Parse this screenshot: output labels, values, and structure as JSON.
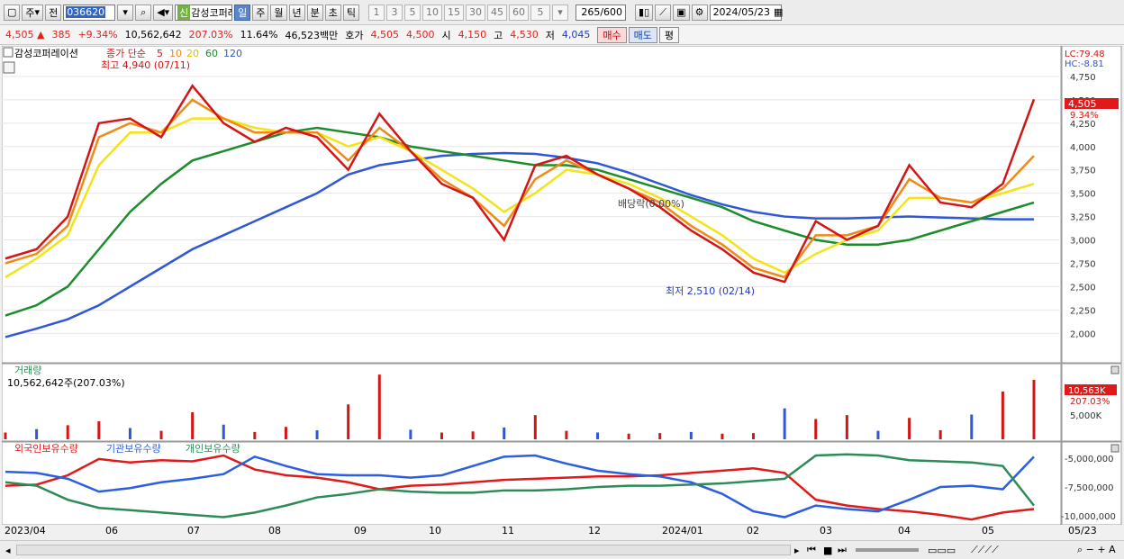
{
  "toolbar": {
    "type_select": "주",
    "prev_label": "전",
    "stock_code": "036620",
    "stock_name": "감성코퍼레",
    "new_badge": "신",
    "periods": [
      "일",
      "주",
      "월",
      "년",
      "분",
      "초",
      "틱"
    ],
    "active_period": "일",
    "intervals": [
      "1",
      "3",
      "5",
      "10",
      "15",
      "30",
      "45",
      "60"
    ],
    "interval_value": "5",
    "count": "265",
    "count_total": "/600",
    "date": "2024/05/23"
  },
  "info": {
    "price": "4,505",
    "change_arrow": "▲",
    "change": "385",
    "change_pct": "+9.34%",
    "volume": "10,562,642",
    "volume_ratio": "207.03%",
    "turnover": "11.64%",
    "amount": "46,523백만",
    "bid_label": "호가",
    "ask": "4,505",
    "bid": "4,500",
    "open_label": "시",
    "open": "4,150",
    "high_label": "고",
    "high": "4,530",
    "low_label": "저",
    "low": "4,045",
    "buy_btn": "매수",
    "sell_btn": "매도",
    "avg_btn": "평"
  },
  "main_chart": {
    "name_label": "감성코퍼레이션",
    "ma_label": "종가 단순",
    "ma_periods": [
      "5",
      "10",
      "20",
      "60",
      "120"
    ],
    "ma_colors": [
      "#d41515",
      "#f08a14",
      "#f2e419",
      "#1d8c2a",
      "#2f57d6"
    ],
    "high_note": "최고 4,940 (07/11)",
    "low_note": "최저 2,510 (02/14)",
    "dividend_note": "배당락(0.00%)",
    "lc": "LC:79.48",
    "hc": "HC:-8.81",
    "last_price_tag": "4,505",
    "last_pct_tag": "9.34%",
    "y_ticks": [
      "4,750",
      "4,500",
      "4,250",
      "4,000",
      "3,750",
      "3,500",
      "3,250",
      "3,000",
      "2,750",
      "2,500",
      "2,250",
      "2,000"
    ]
  },
  "volume_panel": {
    "title": "거래량",
    "value_label": "10,562,642주(207.03%)",
    "last_tag": "10,563K",
    "pct_tag": "207.03%",
    "y_tick": "5,000K"
  },
  "holdings_panel": {
    "series": [
      {
        "name": "외국인보유수량",
        "color": "#e01a1a"
      },
      {
        "name": "기관보유수량",
        "color": "#2b5fe0"
      },
      {
        "name": "개인보유수량",
        "color": "#2e8b57"
      }
    ],
    "y_ticks": [
      "-5,000,000",
      "-7,500,000",
      "-10,000,000"
    ]
  },
  "x_axis": [
    "2023/04",
    "06",
    "07",
    "08",
    "09",
    "10",
    "11",
    "12",
    "2024/01",
    "02",
    "03",
    "04",
    "05",
    "05/23"
  ],
  "chart_data": [
    {
      "type": "line",
      "title": "",
      "ylabel": "",
      "ylim": [
        1800,
        5000
      ],
      "series": [
        {
          "name": "",
          "color": "#d41515",
          "values": [
            2800,
            2900,
            3250,
            4250,
            4300,
            4100,
            4650,
            4250,
            4050,
            4200,
            4100,
            3750,
            4350,
            3950,
            3600,
            3450,
            3000,
            3800,
            3900,
            3700,
            3550,
            3350,
            3100,
            2900,
            2650,
            2550,
            3200,
            3000,
            3150,
            3800,
            3400,
            3350,
            3600,
            4505
          ]
        },
        {
          "name": "",
          "color": "#f08a14",
          "values": [
            2750,
            2850,
            3150,
            4100,
            4250,
            4150,
            4500,
            4300,
            4150,
            4150,
            4150,
            3850,
            4200,
            3950,
            3650,
            3450,
            3150,
            3650,
            3850,
            3700,
            3550,
            3400,
            3150,
            2950,
            2700,
            2600,
            3050,
            3050,
            3150,
            3650,
            3450,
            3400,
            3550,
            3900
          ]
        },
        {
          "name": "",
          "color": "#f2e419",
          "values": [
            2600,
            2800,
            3050,
            3800,
            4150,
            4150,
            4300,
            4300,
            4200,
            4150,
            4150,
            4000,
            4100,
            3950,
            3750,
            3550,
            3300,
            3500,
            3750,
            3700,
            3600,
            3450,
            3250,
            3050,
            2800,
            2650,
            2850,
            3000,
            3100,
            3450,
            3450,
            3400,
            3500,
            3600
          ]
        },
        {
          "name": "",
          "color": "#1d8c2a",
          "values": [
            2190,
            2300,
            2500,
            2900,
            3300,
            3600,
            3850,
            3950,
            4050,
            4150,
            4200,
            4150,
            4100,
            4000,
            3950,
            3900,
            3850,
            3800,
            3800,
            3750,
            3650,
            3550,
            3450,
            3350,
            3200,
            3100,
            3000,
            2950,
            2950,
            3000,
            3100,
            3200,
            3300,
            3400
          ]
        },
        {
          "name": "",
          "color": "#2f57d6",
          "values": [
            1960,
            2050,
            2150,
            2300,
            2500,
            2700,
            2900,
            3050,
            3200,
            3350,
            3500,
            3700,
            3800,
            3850,
            3900,
            3920,
            3930,
            3920,
            3880,
            3820,
            3720,
            3600,
            3480,
            3380,
            3300,
            3250,
            3230,
            3230,
            3240,
            3250,
            3240,
            3230,
            3220,
            3220
          ]
        }
      ]
    },
    {
      "type": "bar",
      "title": "",
      "ylim": [
        0,
        12000
      ],
      "values": [
        1200,
        1800,
        2500,
        3200,
        2000,
        1500,
        4800,
        2600,
        1300,
        2200,
        1600,
        6200,
        11500,
        1700,
        1200,
        1400,
        2100,
        4300,
        1500,
        1200,
        1000,
        1100,
        1300,
        1000,
        1100,
        5500,
        3600,
        4300,
        1500,
        3800,
        1600,
        4400,
        8500,
        10563
      ]
    },
    {
      "type": "line",
      "title": "",
      "ylim": [
        -10500000,
        -4000000
      ],
      "series": [
        {
          "name": "외국인보유수량",
          "color": "#e01a1a",
          "values": [
            -7300000,
            -7200000,
            -6400000,
            -5000000,
            -5300000,
            -5100000,
            -5200000,
            -4700000,
            -5900000,
            -6400000,
            -6600000,
            -7000000,
            -7600000,
            -7300000,
            -7200000,
            -7000000,
            -6800000,
            -6700000,
            -6600000,
            -6500000,
            -6500000,
            -6400000,
            -6200000,
            -6000000,
            -5800000,
            -6200000,
            -8500000,
            -9000000,
            -9300000,
            -9500000,
            -9800000,
            -10200000,
            -9600000,
            -9300000
          ]
        },
        {
          "name": "기관보유수량",
          "color": "#2b5fe0",
          "values": [
            -6100000,
            -6200000,
            -6700000,
            -7800000,
            -7500000,
            -7000000,
            -6700000,
            -6300000,
            -4800000,
            -5600000,
            -6300000,
            -6400000,
            -6400000,
            -6600000,
            -6400000,
            -5600000,
            -4800000,
            -4700000,
            -5400000,
            -6000000,
            -6300000,
            -6500000,
            -7000000,
            -8000000,
            -9500000,
            -10000000,
            -9000000,
            -9300000,
            -9500000,
            -8500000,
            -7400000,
            -7300000,
            -7600000,
            -4800000
          ]
        },
        {
          "name": "개인보유수량",
          "color": "#2e8b57",
          "values": [
            -7000000,
            -7300000,
            -8500000,
            -9200000,
            -9400000,
            -9600000,
            -9800000,
            -10000000,
            -9600000,
            -9000000,
            -8300000,
            -8000000,
            -7600000,
            -7800000,
            -7900000,
            -7900000,
            -7700000,
            -7700000,
            -7600000,
            -7400000,
            -7300000,
            -7300000,
            -7200000,
            -7100000,
            -6900000,
            -6700000,
            -4700000,
            -4600000,
            -4700000,
            -5100000,
            -5200000,
            -5300000,
            -5600000,
            -9000000
          ]
        }
      ]
    }
  ]
}
